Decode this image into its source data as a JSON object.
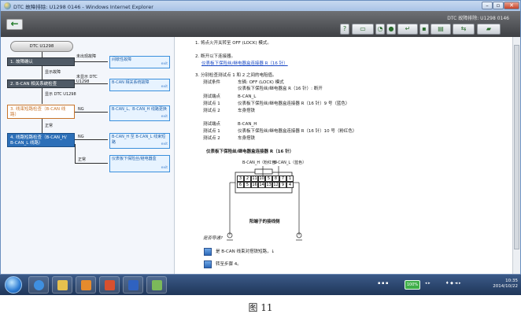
{
  "window": {
    "title": "DTC 故障排除: U1298 0146 - Windows Internet Explorer",
    "min_glyph": "–",
    "max_glyph": "▫",
    "close_glyph": "✕"
  },
  "header": {
    "back_glyph": "←",
    "app_title": "DTC 故障排除: U1298 0146",
    "toolbar_icons": [
      "help-icon",
      "print-icon",
      "flow-icon",
      "user-icon",
      "tool-icon",
      "diag-icon",
      "power-icon",
      "compare-icon",
      "car-icon"
    ]
  },
  "flow": {
    "start": "DTC U1298",
    "steps": [
      {
        "num": "1.",
        "label": "故障确认"
      },
      {
        "num": "2.",
        "label": "B-CAN 相关系统检查"
      },
      {
        "num": "3.",
        "label": "线束短路检查（B-CAN 线路）"
      },
      {
        "num": "4.",
        "label": "线路短路检查（B-CAN_H/ B-CAN_L 线路）"
      }
    ],
    "edge_labels": {
      "not_present": "未出现故障",
      "persists": "显示故障",
      "not_shown": "未显示 DTC U1298",
      "shown": "显示 DTC U1298",
      "ng1": "NG",
      "normal": "正常",
      "ng2": "NG",
      "ok": "正常"
    },
    "results": [
      {
        "text": "间歇性故障",
        "exit": "exit"
      },
      {
        "text": "B-CAN 相关系统故障",
        "exit": "exit"
      },
      {
        "text": "B-CAN_L、B-CAN_H 线路更换",
        "exit": "exit"
      },
      {
        "text": "B-CAN_H 至 B-CAN_L 线束短路",
        "exit": "exit"
      },
      {
        "text": "仪表板下保险丝/继电器盒",
        "exit": "exit"
      }
    ]
  },
  "content": {
    "steps": [
      "1. 将点火开关转至 OFF (LOCK) 模式。",
      "2. 断开以下连接器。",
      "3. 分别检查测试点 1 和 2 之间的电阻值。"
    ],
    "connector_link": "仪表板下保险丝/继电器盒连接器 R（16 针）",
    "table": [
      [
        "测试条件",
        "车辆: OFF (LOCK) 模式"
      ],
      [
        "",
        "仪表板下保险丝/继电器盒 R（16 针）: 断开"
      ],
      [
        "测试端点",
        "B-CAN_L"
      ],
      [
        "测试点 1",
        "仪表板下保险丝/继电器盒连接器 R（16 针）9 号（蓝色）"
      ],
      [
        "测试点 2",
        "车身搭铁"
      ],
      [
        "测试端点",
        "B-CAN_H"
      ],
      [
        "测试点 1",
        "仪表板下保险丝/继电器盒连接器 R（16 针）10 号（粉红色）"
      ],
      [
        "测试点 2",
        "车身搭铁"
      ]
    ],
    "diagram_title": "仪表板下保险丝/继电器盒连接器 R（16 针）",
    "diagram_labels": [
      "B-CAN_H（粉红色）",
      "B-CAN_L（蓝色）"
    ],
    "pins_top": [
      "3",
      "2",
      "11",
      "10",
      "5",
      "8",
      "7",
      "1"
    ],
    "pins_bottom": [
      "6",
      "5",
      "16",
      "14",
      "13",
      "12",
      "9",
      "4"
    ],
    "diagram_caption": "阳端子的接线侧",
    "question": "是否导通?",
    "answers": [
      "是 B-CAN 线束对搭铁短路，↓",
      "转至步骤 4。"
    ]
  },
  "taskbar": {
    "zoom": "100%",
    "clock_time": "10:35",
    "clock_date": "2014/10/22"
  },
  "caption": "图 11"
}
